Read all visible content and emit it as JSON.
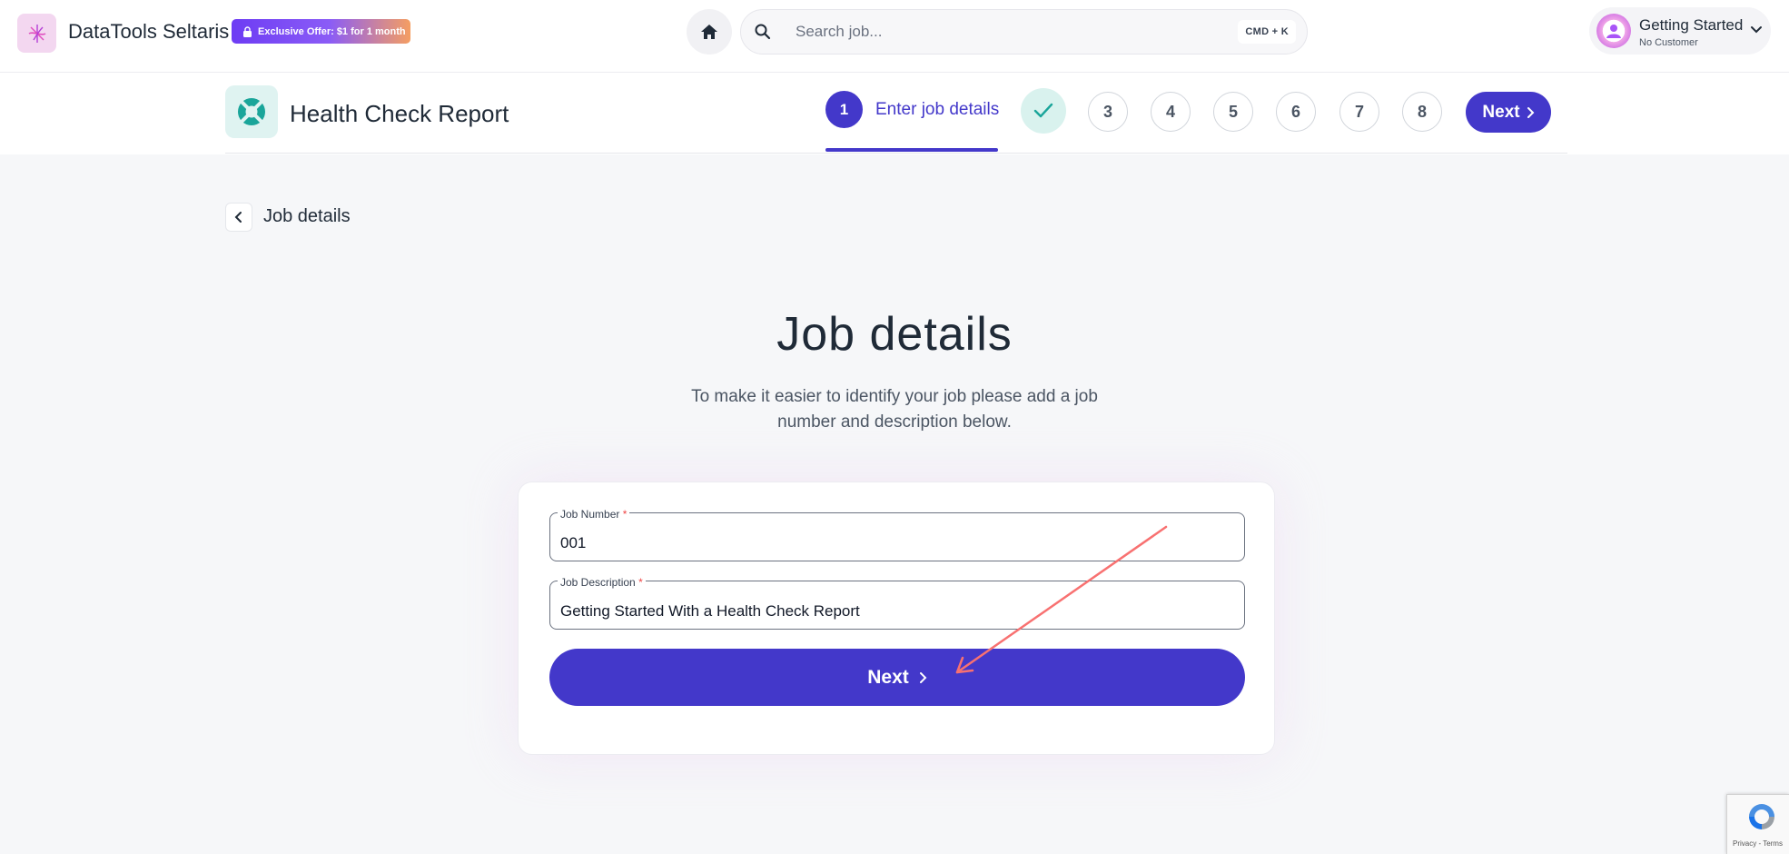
{
  "header": {
    "brand": "DataTools Seltaris",
    "offer_badge": "Exclusive Offer: $1 for 1 month",
    "search_placeholder": "Search job...",
    "search_shortcut": "CMD + K",
    "user": {
      "name": "Getting Started",
      "subtitle": "No Customer"
    }
  },
  "stepper": {
    "report_title": "Health Check Report",
    "current_step": {
      "number": "1",
      "label": "Enter job details"
    },
    "steps": [
      "3",
      "4",
      "5",
      "6",
      "7",
      "8"
    ],
    "next_label": "Next"
  },
  "back": {
    "label": "Job details"
  },
  "main": {
    "title": "Job details",
    "description": "To make it easier to identify your job please add a job number and description below.",
    "form": {
      "job_number": {
        "label": "Job Number",
        "required_mark": "*",
        "value": "001"
      },
      "job_description": {
        "label": "Job Description",
        "required_mark": "*",
        "value": "Getting Started With a Health Check Report"
      },
      "next_label": "Next"
    }
  },
  "recaptcha": {
    "footer": "Privacy - Terms"
  },
  "colors": {
    "primary": "#4338ca",
    "annotation": "#f87171",
    "check_bg": "#d9f2ee",
    "teal": "#1aa59a"
  }
}
